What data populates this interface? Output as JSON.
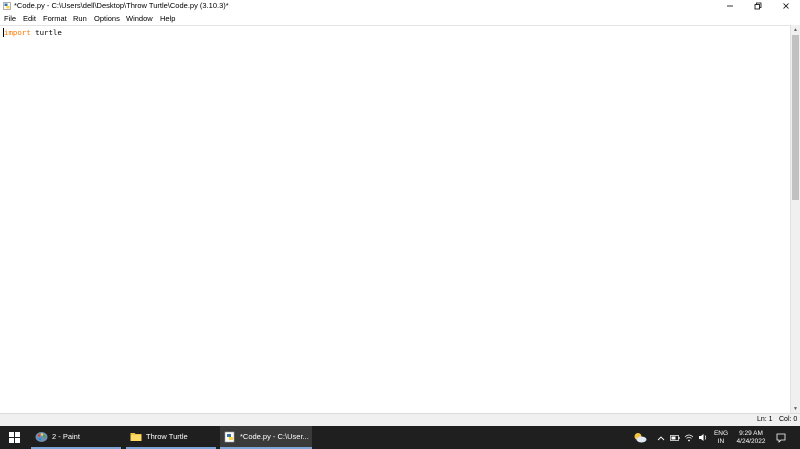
{
  "window": {
    "title": "*Code.py - C:\\Users\\dell\\Desktop\\Throw Turtle\\Code.py (3.10.3)*"
  },
  "menu": [
    "File",
    "Edit",
    "Format",
    "Run",
    "Options",
    "Window",
    "Help"
  ],
  "editor": {
    "keyword": "import",
    "rest": " turtle"
  },
  "status": {
    "line": "Ln: 1",
    "col": "Col: 0"
  },
  "taskbar": {
    "items": [
      {
        "label": "2 - Paint"
      },
      {
        "label": "Throw Turtle"
      },
      {
        "label": "*Code.py - C:\\User..."
      }
    ],
    "tray": {
      "lang_top": "ENG",
      "lang_bottom": "IN",
      "time": "9:29 AM",
      "date": "4/24/2022"
    }
  },
  "colors": {
    "keyword": "#ff7700",
    "taskbar_bg": "#1f1f1f"
  }
}
